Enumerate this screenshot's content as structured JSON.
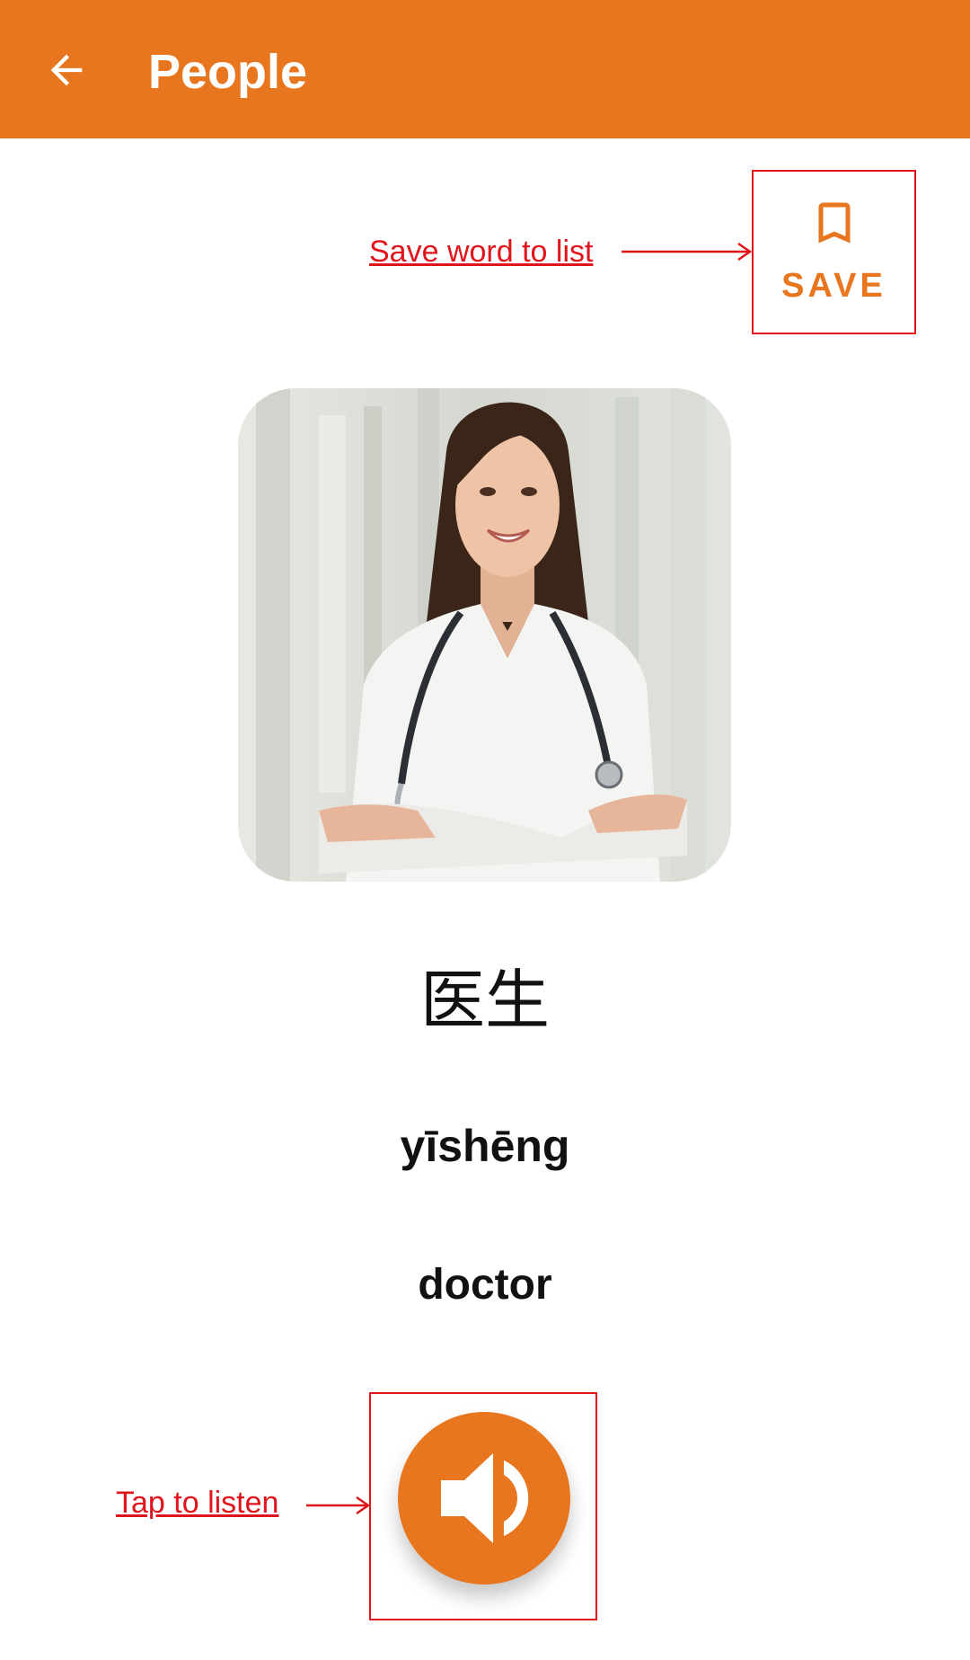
{
  "app_bar": {
    "title": "People",
    "back_icon": "arrow-left-icon",
    "color": "#E8761E"
  },
  "save": {
    "label": "SAVE",
    "icon": "bookmark-outline-icon"
  },
  "annotations": {
    "save": "Save word to list",
    "listen": "Tap to listen",
    "color": "#E0141B"
  },
  "word": {
    "hanzi": "医生",
    "pinyin": "yīshēng",
    "meaning": "doctor",
    "image": "photo of a smiling female doctor in white coat with stethoscope"
  },
  "audio": {
    "icon": "volume-speaker-icon"
  }
}
